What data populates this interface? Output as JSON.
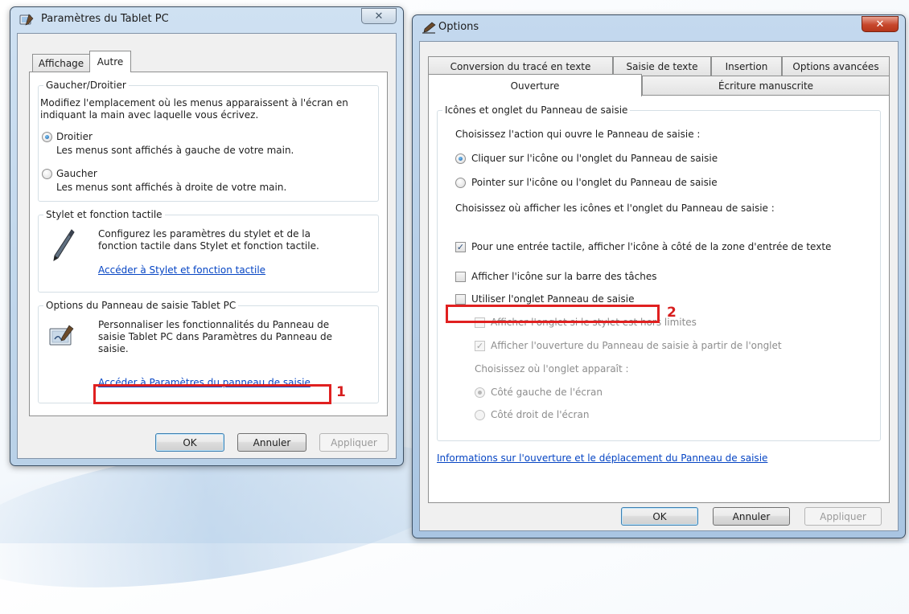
{
  "colors": {
    "accent_red": "#e02020",
    "link": "#0645c4",
    "close_red": "#c6472c"
  },
  "window1": {
    "title": "Paramètres du Tablet PC",
    "icon": "tablet-settings-icon",
    "close": "✕",
    "tabs": [
      "Affichage",
      "Autre"
    ],
    "active_tab": "Autre",
    "handedness": {
      "legend": "Gaucher/Droitier",
      "description": "Modifiez l'emplacement où les menus apparaissent à l'écran en indiquant la main avec laquelle vous écrivez.",
      "options": [
        {
          "label": "Droitier",
          "desc": "Les menus sont affichés à gauche de votre main.",
          "checked": true
        },
        {
          "label": "Gaucher",
          "desc": "Les menus sont affichés à droite de votre main.",
          "checked": false
        }
      ]
    },
    "pen": {
      "legend": "Stylet et fonction tactile",
      "description": "Configurez les paramètres du stylet et de la fonction tactile dans Stylet et fonction tactile.",
      "link": "Accéder à Stylet et fonction tactile",
      "icon": "pen-icon"
    },
    "input_panel": {
      "legend": "Options du Panneau de saisie Tablet PC",
      "description": "Personnaliser les fonctionnalités du Panneau de saisie Tablet PC dans Paramètres du Panneau de saisie.",
      "link": "Accéder à Paramètres du panneau de saisie",
      "icon": "input-panel-icon",
      "step": "1"
    },
    "buttons": {
      "ok": "OK",
      "cancel": "Annuler",
      "apply": "Appliquer"
    }
  },
  "window2": {
    "title": "Options",
    "icon": "options-pen-icon",
    "close": "✕",
    "tabs_row1": [
      "Conversion du tracé en texte",
      "Saisie de texte",
      "Insertion",
      "Options avancées"
    ],
    "tabs_row2": [
      "Ouverture",
      "Écriture manuscrite"
    ],
    "active_tab": "Ouverture",
    "group_legend": "Icônes et onglet du Panneau de saisie",
    "choose_action": "Choisissez l'action qui ouvre le Panneau de saisie :",
    "action_options": [
      {
        "label": "Cliquer sur l'icône ou l'onglet du Panneau de saisie",
        "checked": true
      },
      {
        "label": "Pointer sur l'icône ou l'onglet du Panneau de saisie",
        "checked": false
      }
    ],
    "choose_where": "Choisissez où afficher les icônes et l'onglet du Panneau de saisie :",
    "checkboxes": [
      {
        "label": "Pour une entrée tactile, afficher l'icône à côté de la zone d'entrée de texte",
        "checked": true
      },
      {
        "label": "Afficher l'icône sur la barre des tâches",
        "checked": false
      },
      {
        "label": "Utiliser l'onglet Panneau de saisie",
        "checked": false
      }
    ],
    "step": "2",
    "sub_checkboxes": [
      {
        "label": "Afficher l'onglet si le stylet est hors limites",
        "checked": false
      },
      {
        "label": "Afficher l'ouverture du Panneau de saisie à partir de l'onglet",
        "checked": true
      }
    ],
    "tab_position_label": "Choisissez où l'onglet apparaît :",
    "tab_position_options": [
      {
        "label": "Côté gauche de l'écran",
        "checked": true
      },
      {
        "label": "Côté droit de l'écran",
        "checked": false
      }
    ],
    "info_link": "Informations sur l'ouverture et le déplacement du Panneau de saisie",
    "buttons": {
      "ok": "OK",
      "cancel": "Annuler",
      "apply": "Appliquer"
    }
  }
}
